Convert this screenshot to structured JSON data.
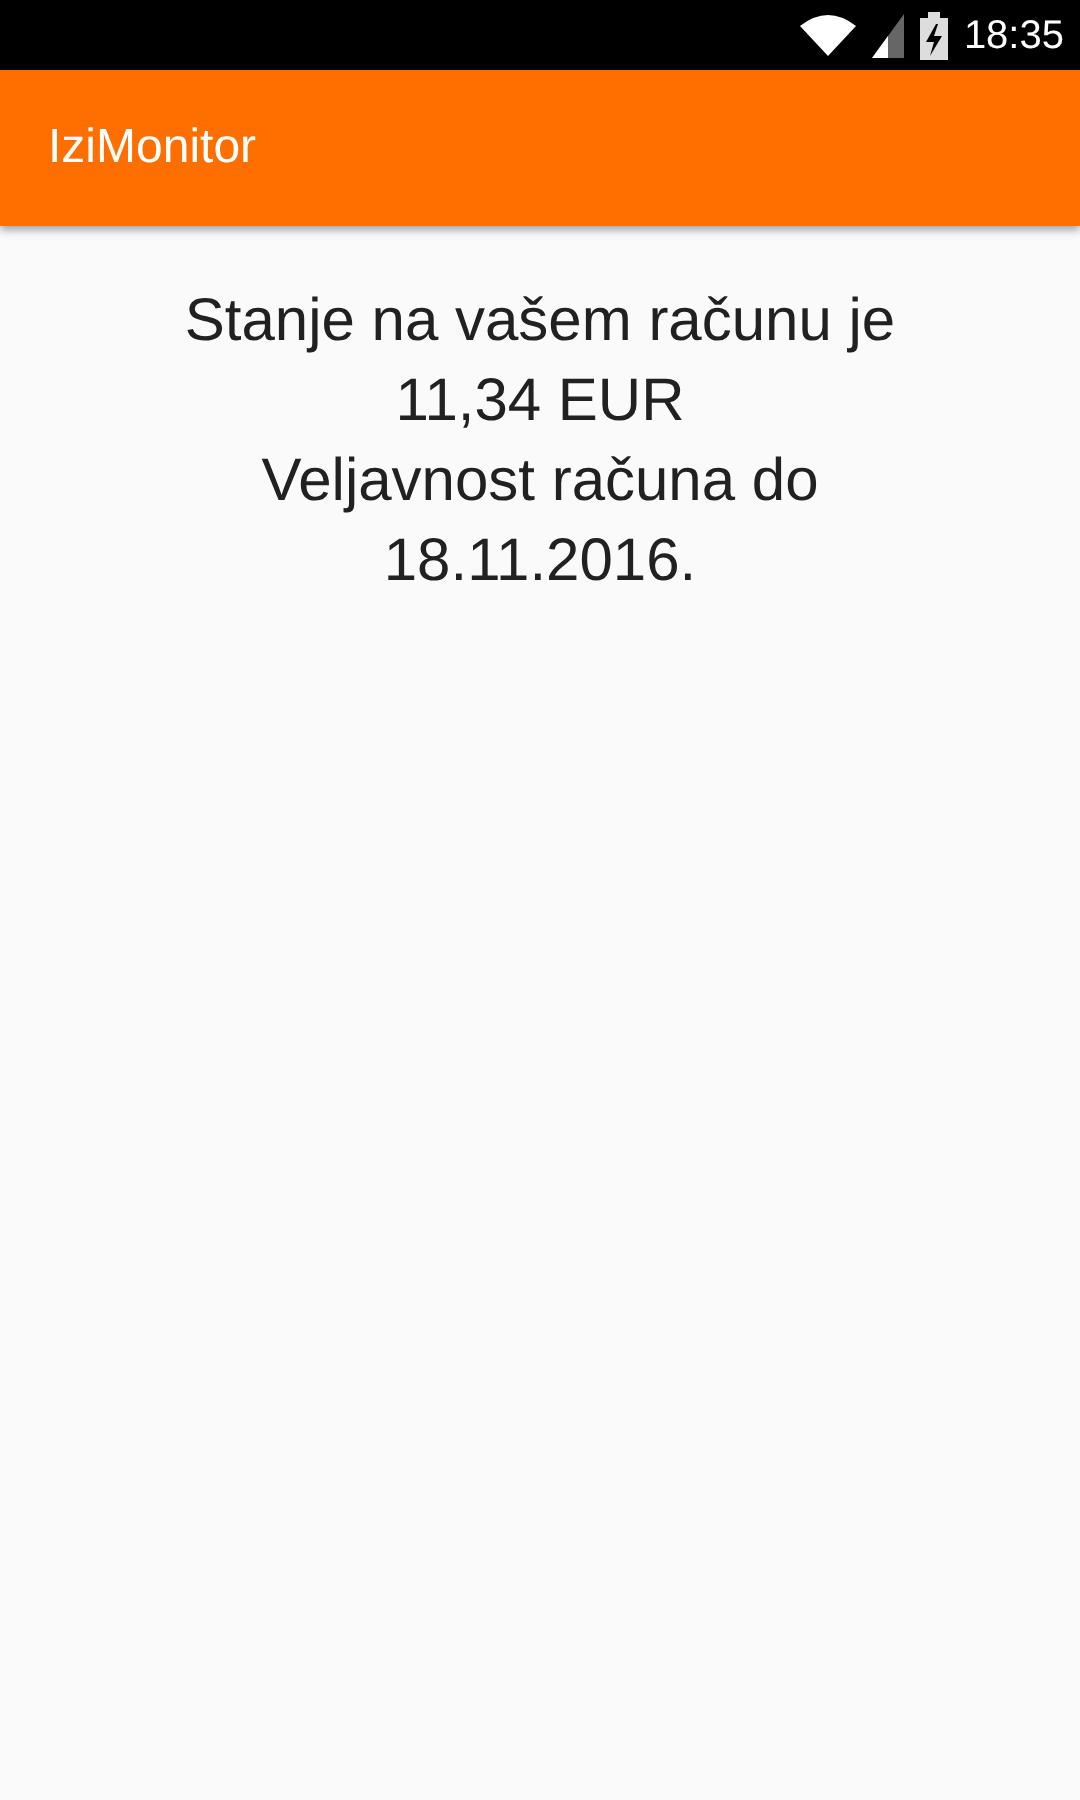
{
  "status_bar": {
    "time": "18:35"
  },
  "app_bar": {
    "title": "IziMonitor"
  },
  "content": {
    "lines": [
      "Stanje na vašem računu je 11,34 EUR",
      "Veljavnost računa do 18.11.2016."
    ]
  }
}
